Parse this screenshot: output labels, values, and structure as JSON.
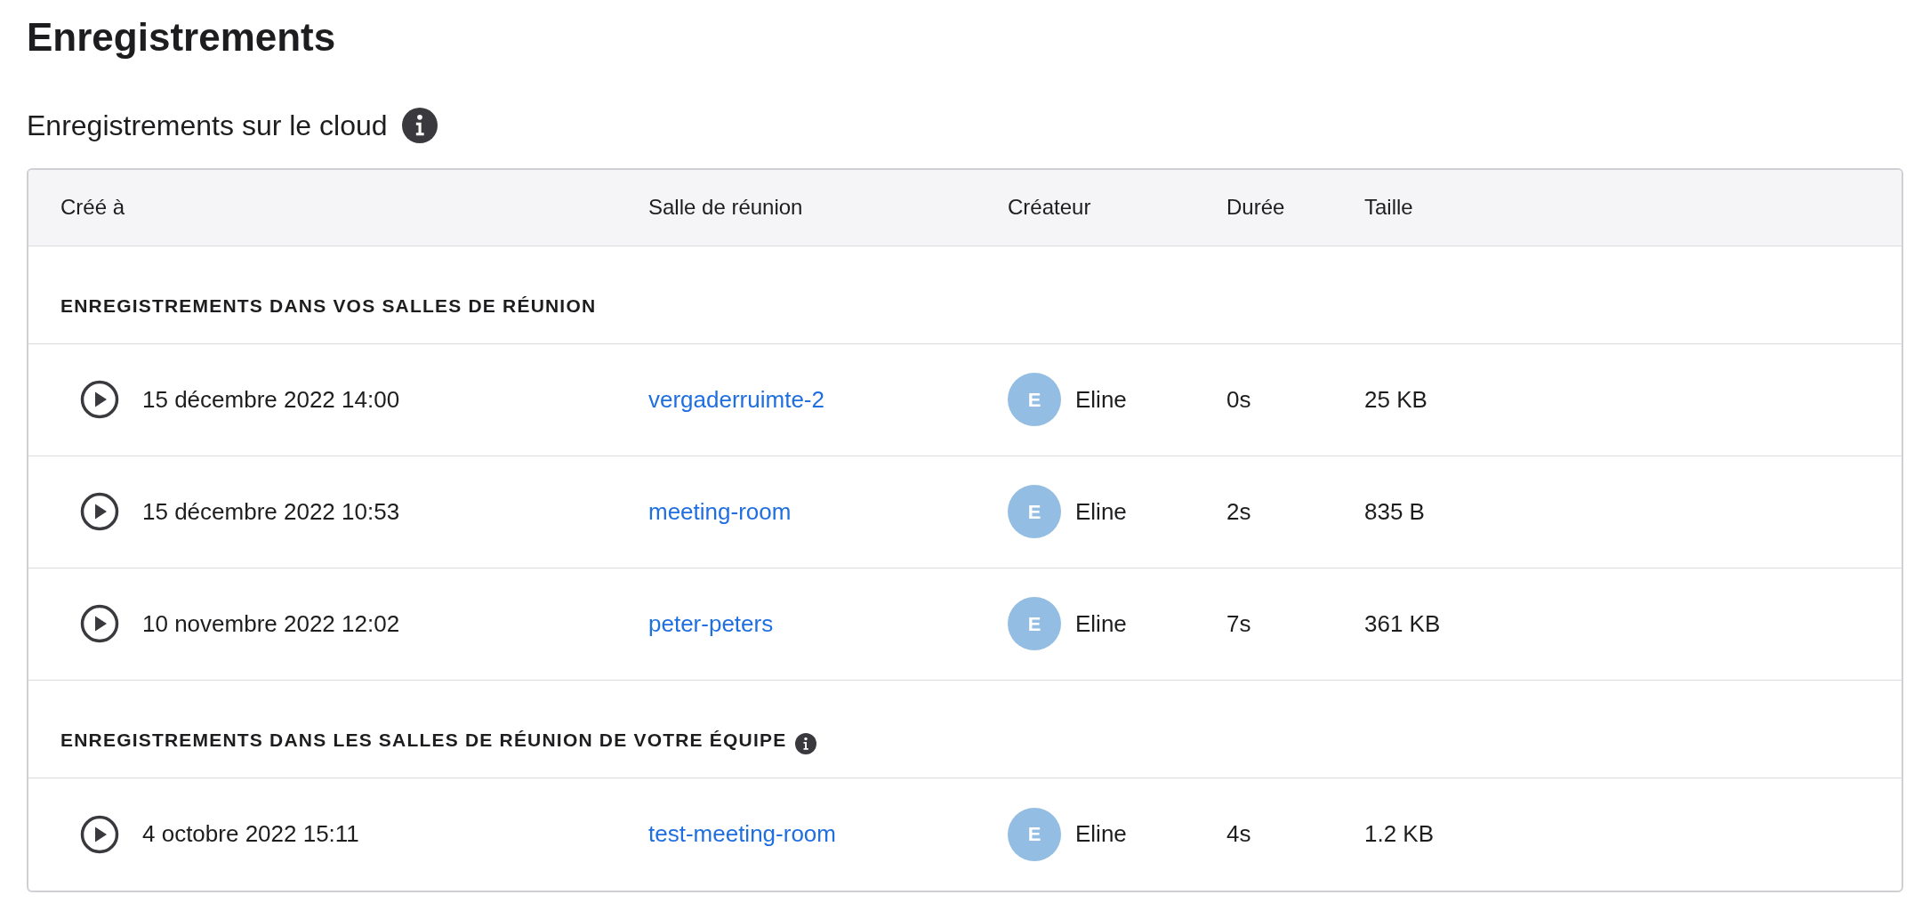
{
  "page_title": "Enregistrements",
  "section_title": "Enregistrements sur le cloud",
  "section_info": true,
  "table": {
    "columns": [
      "Créé à",
      "Salle de réunion",
      "Créateur",
      "Durée",
      "Taille"
    ],
    "groups": [
      {
        "title": "ENREGISTREMENTS DANS VOS SALLES DE RÉUNION",
        "info": false,
        "rows": [
          {
            "created": "15 décembre 2022 14:00",
            "room": "vergaderruimte-2",
            "initial": "E",
            "creator": "Eline",
            "duration": "0s",
            "size": "25 KB"
          },
          {
            "created": "15 décembre 2022 10:53",
            "room": "meeting-room",
            "initial": "E",
            "creator": "Eline",
            "duration": "2s",
            "size": "835 B"
          },
          {
            "created": "10 novembre 2022 12:02",
            "room": "peter-peters",
            "initial": "E",
            "creator": "Eline",
            "duration": "7s",
            "size": "361 KB"
          }
        ]
      },
      {
        "title": "ENREGISTREMENTS DANS LES SALLES DE RÉUNION DE VOTRE ÉQUIPE",
        "info": true,
        "rows": [
          {
            "created": "4 octobre 2022 15:11",
            "room": "test-meeting-room",
            "initial": "E",
            "creator": "Eline",
            "duration": "4s",
            "size": "1.2 KB"
          }
        ]
      }
    ]
  }
}
